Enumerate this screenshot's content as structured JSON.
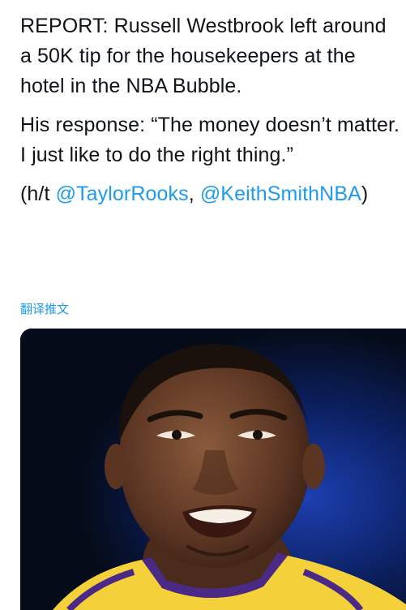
{
  "tweet": {
    "paragraph1": "REPORT: Russell Westbrook left around a 50K tip for the housekeepers at the hotel in the NBA Bubble.",
    "paragraph2": "His response: “The money doesn’t matter. I just like to do the right thing.”",
    "credit_prefix": "(h/t ",
    "mention1": "@TaylorRooks",
    "separator": ", ",
    "mention2": "@KeithSmithNBA",
    "credit_suffix": ")"
  },
  "translate_label": "翻译推文",
  "media": {
    "image_alt": "Photo of Russell Westbrook smiling in a Lakers jersey"
  },
  "colors": {
    "link": "#1d9bf0",
    "text": "#0f1419",
    "jersey_gold": "#f4d03a",
    "jersey_purple": "#4a2a86",
    "background_blue": "#0c2a7a"
  }
}
